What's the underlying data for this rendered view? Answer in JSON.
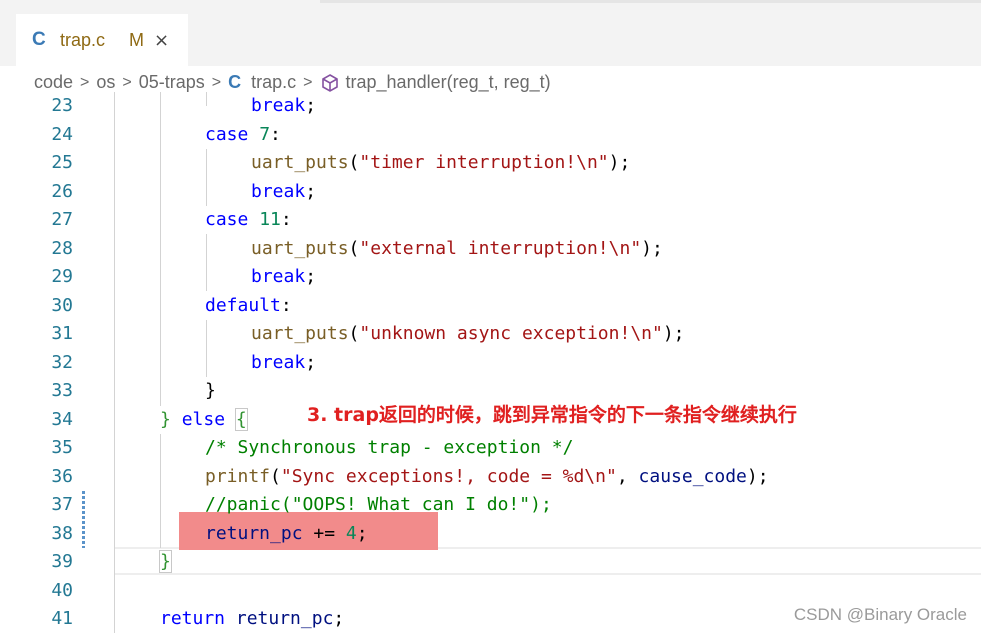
{
  "tab": {
    "icon": "C",
    "filename": "trap.c",
    "modified_badge": "M",
    "close_icon": "×"
  },
  "breadcrumb": {
    "items": [
      "code",
      "os",
      "05-traps"
    ],
    "file_icon": "C",
    "file": "trap.c",
    "symbol": "trap_handler(reg_t, reg_t)"
  },
  "editor": {
    "line_numbers": [
      "23",
      "24",
      "25",
      "26",
      "27",
      "28",
      "29",
      "30",
      "31",
      "32",
      "33",
      "34",
      "35",
      "36",
      "37",
      "38",
      "39",
      "40",
      "41"
    ]
  },
  "code": {
    "l23_break": "break",
    "l24_case": "case",
    "l24_num": "7",
    "l25_fn": "uart_puts",
    "l25_str": "\"timer interruption!\\n\"",
    "l26_break": "break",
    "l27_case": "case",
    "l27_num": "11",
    "l28_fn": "uart_puts",
    "l28_str": "\"external interruption!\\n\"",
    "l29_break": "break",
    "l30_default": "default",
    "l31_fn": "uart_puts",
    "l31_str": "\"unknown async exception!\\n\"",
    "l32_break": "break",
    "l34_else": "else",
    "l35_comment": "/* Synchronous trap - exception */",
    "l36_fn": "printf",
    "l36_str": "\"Sync exceptions!, code = %d\\n\"",
    "l36_var": "cause_code",
    "l37_comment": "//panic(\"OOPS! What can I do!\");",
    "l38_var": "return_pc",
    "l38_num": "4",
    "l41_return": "return",
    "l41_var": "return_pc"
  },
  "annotation": "3. trap返回的时候，跳到异常指令的下一条指令继续执行",
  "watermark": "CSDN @Binary Oracle",
  "colors": {
    "highlight": "#f28b8b",
    "annotation": "#e02020",
    "keyword": "#0000ff",
    "string": "#a31515",
    "comment": "#008000"
  }
}
